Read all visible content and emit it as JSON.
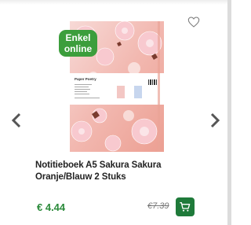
{
  "product": {
    "badge_line1": "Enkel",
    "badge_line2": "online",
    "title": "Notitieboek A5 Sakura Sakura Oranje/Blauw 2 Stuks",
    "price": "€ 4.44",
    "old_price": "€7.39",
    "image_brand_text": "Paper Poetry"
  },
  "icons": {
    "wishlist": "heart-outline-icon",
    "prev": "chevron-left-icon",
    "next": "chevron-right-icon",
    "cart": "cart-icon"
  },
  "colors": {
    "badge": "#3c9e3c",
    "price": "#2a8a3a",
    "cart_button": "#1f7a3a"
  }
}
